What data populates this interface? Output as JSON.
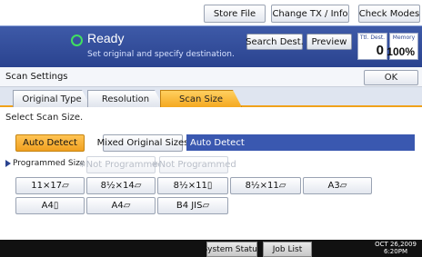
{
  "top_buttons": {
    "store_file": "Store File",
    "change_tx_info": "Change TX / Info",
    "check_modes": "Check Modes"
  },
  "status": {
    "title": "Ready",
    "subtitle": "Set original and specify destination.",
    "icon": "ready-circle-icon",
    "icon_color": "#40e060"
  },
  "banner_buttons": {
    "search_dest": "Search Dest.",
    "preview": "Preview"
  },
  "counters": {
    "tx_dest_label": "Ttl. Dest.",
    "tx_dest_value": "0",
    "memory_label": "Memory",
    "memory_value": "100%"
  },
  "settings": {
    "title": "Scan Settings",
    "ok_label": "OK"
  },
  "tabs": [
    {
      "label": "Original Type",
      "active": false
    },
    {
      "label": "Resolution",
      "active": false
    },
    {
      "label": "Scan Size",
      "active": true
    }
  ],
  "scan_size": {
    "section_label": "Select Scan Size.",
    "auto_detect_label": "Auto Detect",
    "mixed_sizes_label": "Mixed Original Sizes",
    "current_selection": "Auto Detect",
    "programmed_label": "Programmed Size",
    "programmed_slots": [
      "※Not Programmed",
      "※Not Programmed"
    ],
    "sizes_row1": [
      "11×17▱",
      "8½×14▱",
      "8½×11▯",
      "8½×11▱",
      "A3▱"
    ],
    "sizes_row2": [
      "A4▯",
      "A4▱",
      "B4 JIS▱"
    ]
  },
  "bottom": {
    "system_status": "System Status",
    "job_list": "Job List",
    "date": "OCT  26,2009",
    "time": "6:20PM"
  },
  "colors": {
    "accent_orange": "#f4a820",
    "banner_blue": "#2a438f"
  }
}
